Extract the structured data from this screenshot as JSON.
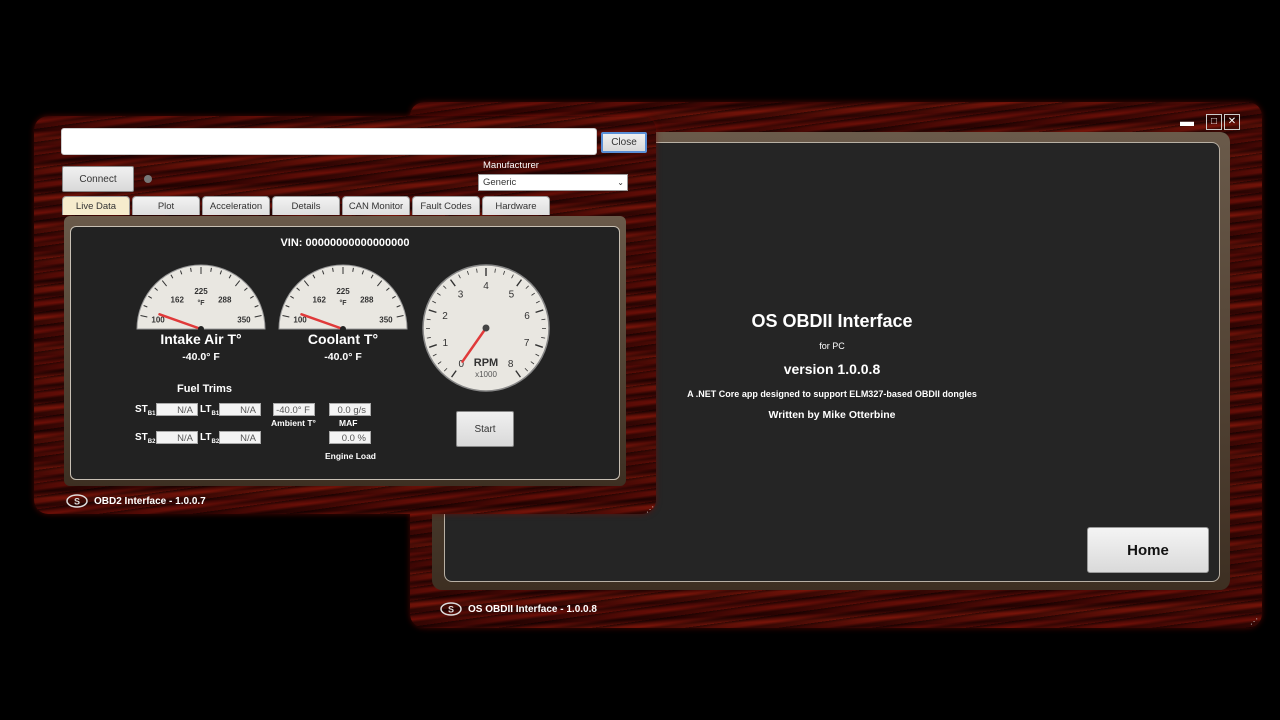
{
  "back_window": {
    "app_title": "OS OBDII Interface",
    "platform": "for PC",
    "version": "version 1.0.0.8",
    "description": "A .NET Core app designed to support ELM327-based OBDII dongles",
    "author": "Written by Mike Otterbine",
    "home_label": "Home",
    "status_title": "OS OBDII Interface - 1.0.0.8",
    "controls": {
      "minimize": "▬",
      "maximize": "□",
      "close": "✕"
    }
  },
  "front_window": {
    "url_value": "",
    "close_label": "Close",
    "connect_label": "Connect",
    "manufacturer_label": "Manufacturer",
    "manufacturer_value": "Generic",
    "tabs": [
      {
        "label": "Live Data"
      },
      {
        "label": "Plot"
      },
      {
        "label": "Acceleration"
      },
      {
        "label": "Details"
      },
      {
        "label": "CAN Monitor"
      },
      {
        "label": "Fault Codes"
      },
      {
        "label": "Hardware"
      }
    ],
    "vin": "VIN: 00000000000000000",
    "gauges": {
      "intake": {
        "title": "Intake Air T°",
        "value": "-40.0° F",
        "ticks": [
          "100",
          "162",
          "225",
          "288",
          "350"
        ],
        "unit": "°F",
        "level": 0
      },
      "coolant": {
        "title": "Coolant T°",
        "value": "-40.0° F",
        "ticks": [
          "100",
          "162",
          "225",
          "288",
          "350"
        ],
        "unit": "°F",
        "level": 0
      },
      "rpm": {
        "label": "RPM",
        "scale": "x1000",
        "ticks": [
          "0",
          "1",
          "2",
          "3",
          "4",
          "5",
          "6",
          "7",
          "8"
        ],
        "level": 0
      }
    },
    "fuel_trims": {
      "title": "Fuel Trims",
      "st": "ST",
      "lt": "LT",
      "b1": "B1",
      "b2": "B2",
      "st_b1": "N/A",
      "lt_b1": "N/A",
      "st_b2": "N/A",
      "lt_b2": "N/A"
    },
    "ambient": {
      "value": "-40.0° F",
      "label": "Ambient T°"
    },
    "maf": {
      "value": "0.0 g/s",
      "label": "MAF"
    },
    "engine_load": {
      "value": "0.0 %",
      "label": "Engine Load"
    },
    "start_label": "Start",
    "status_title": "OBD2 Interface - 1.0.0.7"
  },
  "colors": {
    "needle": "#e03a3a",
    "panel": "#222222",
    "wood": "#5c0c06"
  }
}
